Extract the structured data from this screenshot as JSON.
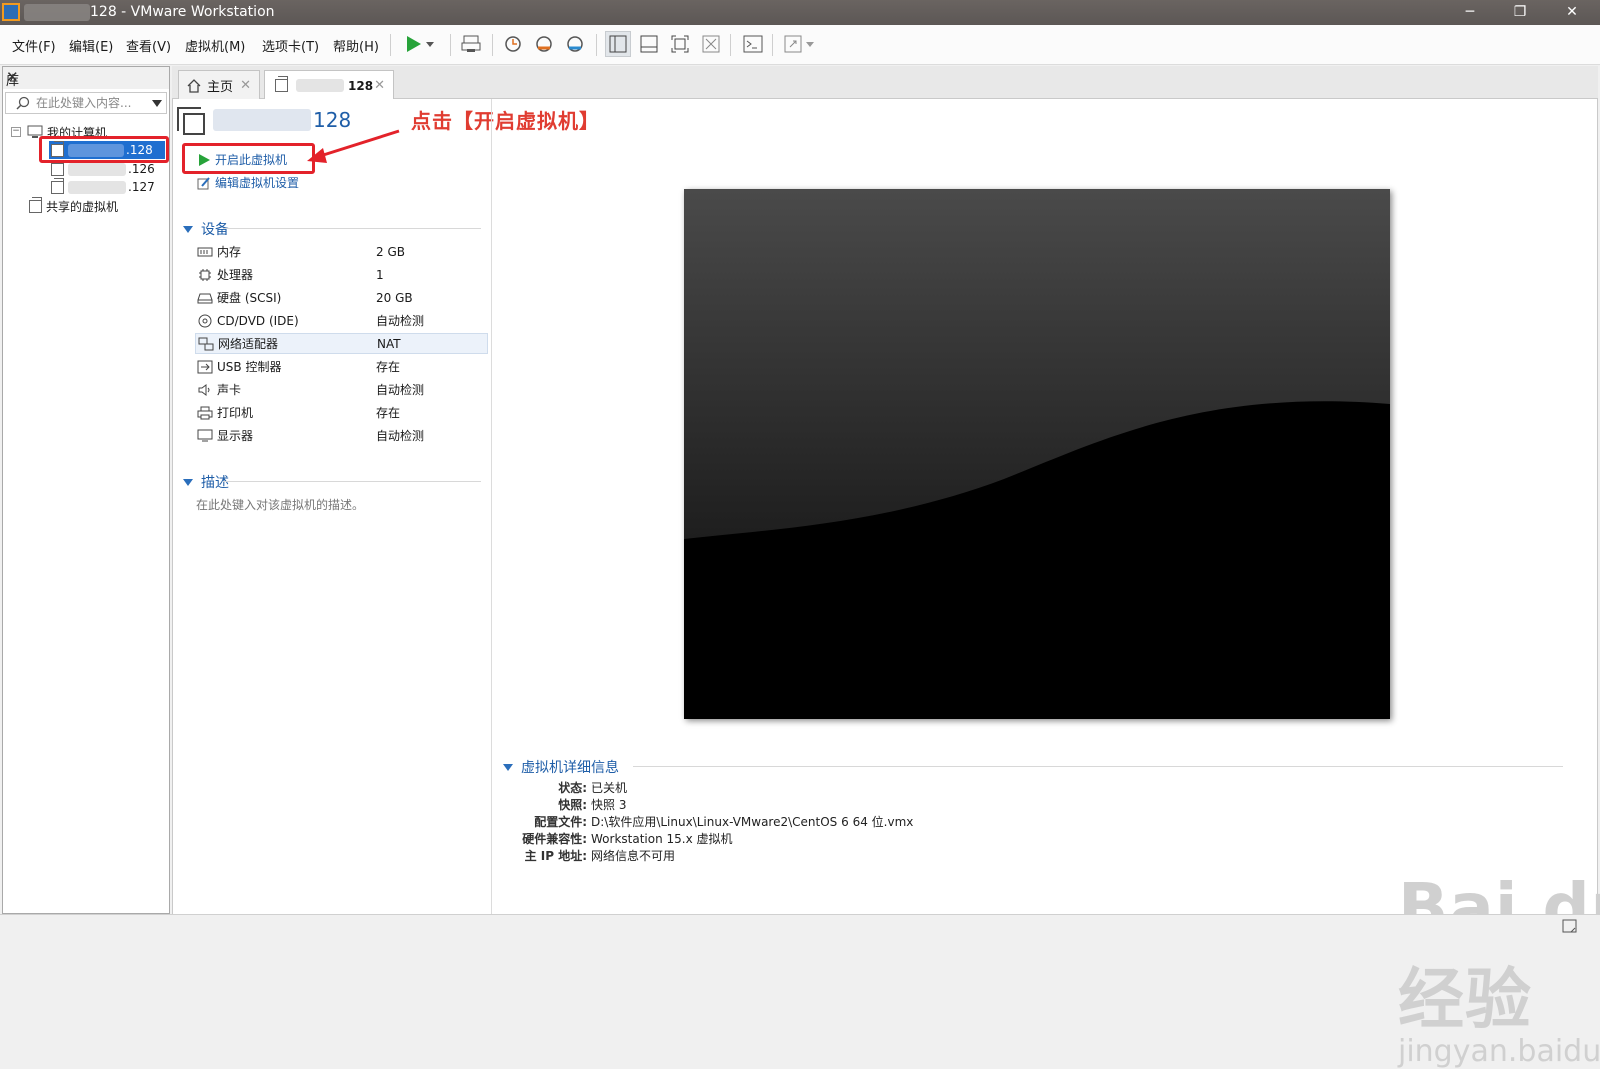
{
  "window": {
    "title": "128 - VMware Workstation",
    "minimize": "─",
    "restore": "❐",
    "close": "✕"
  },
  "menu": [
    "文件(F)",
    "编辑(E)",
    "查看(V)",
    "虚拟机(M)",
    "选项卡(T)",
    "帮助(H)"
  ],
  "library": {
    "title": "库",
    "close": "✕",
    "search_placeholder": "在此处键入内容...",
    "my_computer": "我的计算机",
    "vms": [
      ".128",
      ".126",
      ".127"
    ],
    "shared": "共享的虚拟机"
  },
  "tabs": {
    "home": "主页",
    "vm": "128",
    "close": "✕"
  },
  "vm": {
    "title": "128",
    "power_on": "开启此虚拟机",
    "edit_settings": "编辑虚拟机设置"
  },
  "annotation": "点击【开启虚拟机】",
  "devices": {
    "header": "设备",
    "items": [
      {
        "name": "内存",
        "value": "2 GB",
        "icon": "memory-icon"
      },
      {
        "name": "处理器",
        "value": "1",
        "icon": "cpu-icon"
      },
      {
        "name": "硬盘 (SCSI)",
        "value": "20 GB",
        "icon": "disk-icon"
      },
      {
        "name": "CD/DVD (IDE)",
        "value": "自动检测",
        "icon": "cd-icon"
      },
      {
        "name": "网络适配器",
        "value": "NAT",
        "icon": "network-icon"
      },
      {
        "name": "USB 控制器",
        "value": "存在",
        "icon": "usb-icon"
      },
      {
        "name": "声卡",
        "value": "自动检测",
        "icon": "sound-icon"
      },
      {
        "name": "打印机",
        "value": "存在",
        "icon": "printer-icon"
      },
      {
        "name": "显示器",
        "value": "自动检测",
        "icon": "display-icon"
      }
    ]
  },
  "description": {
    "header": "描述",
    "placeholder": "在此处键入对该虚拟机的描述。"
  },
  "details": {
    "header": "虚拟机详细信息",
    "rows": [
      {
        "key": "状态:",
        "value": "已关机"
      },
      {
        "key": "快照:",
        "value": "快照 3"
      },
      {
        "key": "配置文件:",
        "value": "D:\\软件应用\\Linux\\Linux-VMware2\\CentOS 6 64 位.vmx"
      },
      {
        "key": "硬件兼容性:",
        "value": "Workstation 15.x 虚拟机"
      },
      {
        "key": "主 IP 地址:",
        "value": "网络信息不可用"
      }
    ]
  },
  "watermark": {
    "brand": "Bai du 经验",
    "url": "jingyan.baidu.com"
  },
  "colors": {
    "link": "#1f5ea8",
    "annotation": "#e03c31",
    "titlebar": "#5c5755"
  }
}
